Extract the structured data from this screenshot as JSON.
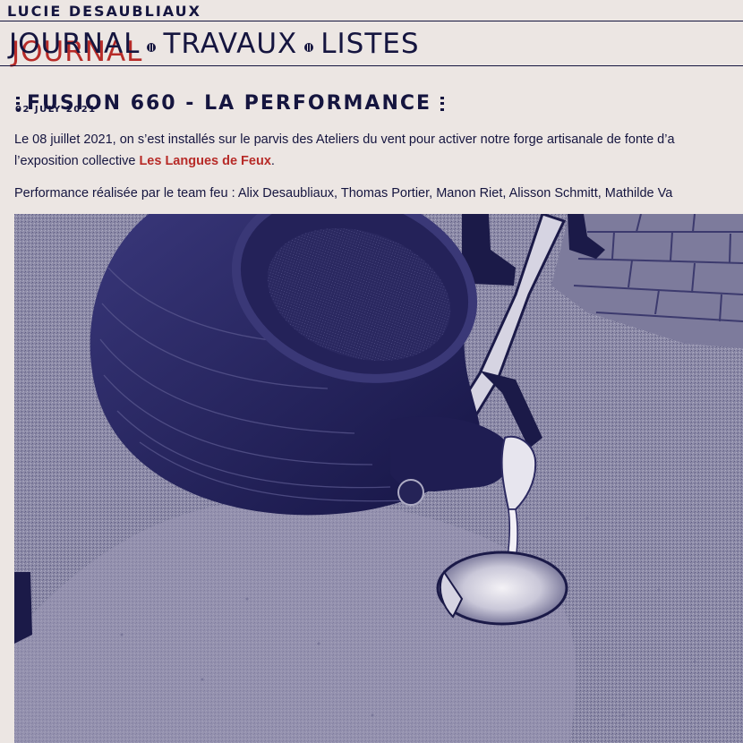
{
  "site": {
    "name": "LUCIE DESAUBLIAUX"
  },
  "nav": {
    "items": [
      {
        "label": "JOURNAL",
        "active": true
      },
      {
        "label": "TRAVAUX",
        "active": false
      },
      {
        "label": "LISTES",
        "active": false
      }
    ]
  },
  "post": {
    "title": "FUSION 660 - LA PERFORMANCE",
    "date": "02 JULY 2021",
    "p1_line1": "Le 08 juillet 2021, on s’est installés sur le parvis des Ateliers du vent pour activer notre forge artisanale de fonte d’a",
    "p1_line2_before": "l’exposition collective ",
    "p1_link": "Les Langues de Feux",
    "p1_line2_after": ".",
    "p2": "Performance réalisée par le team feu : Alix Desaubliaux, Thomas Portier, Manon Riet, Alisson Schmitt, Mathilde Va"
  },
  "colors": {
    "ink": "#15153f",
    "background": "#ece6e3",
    "accent": "#b72b28"
  }
}
